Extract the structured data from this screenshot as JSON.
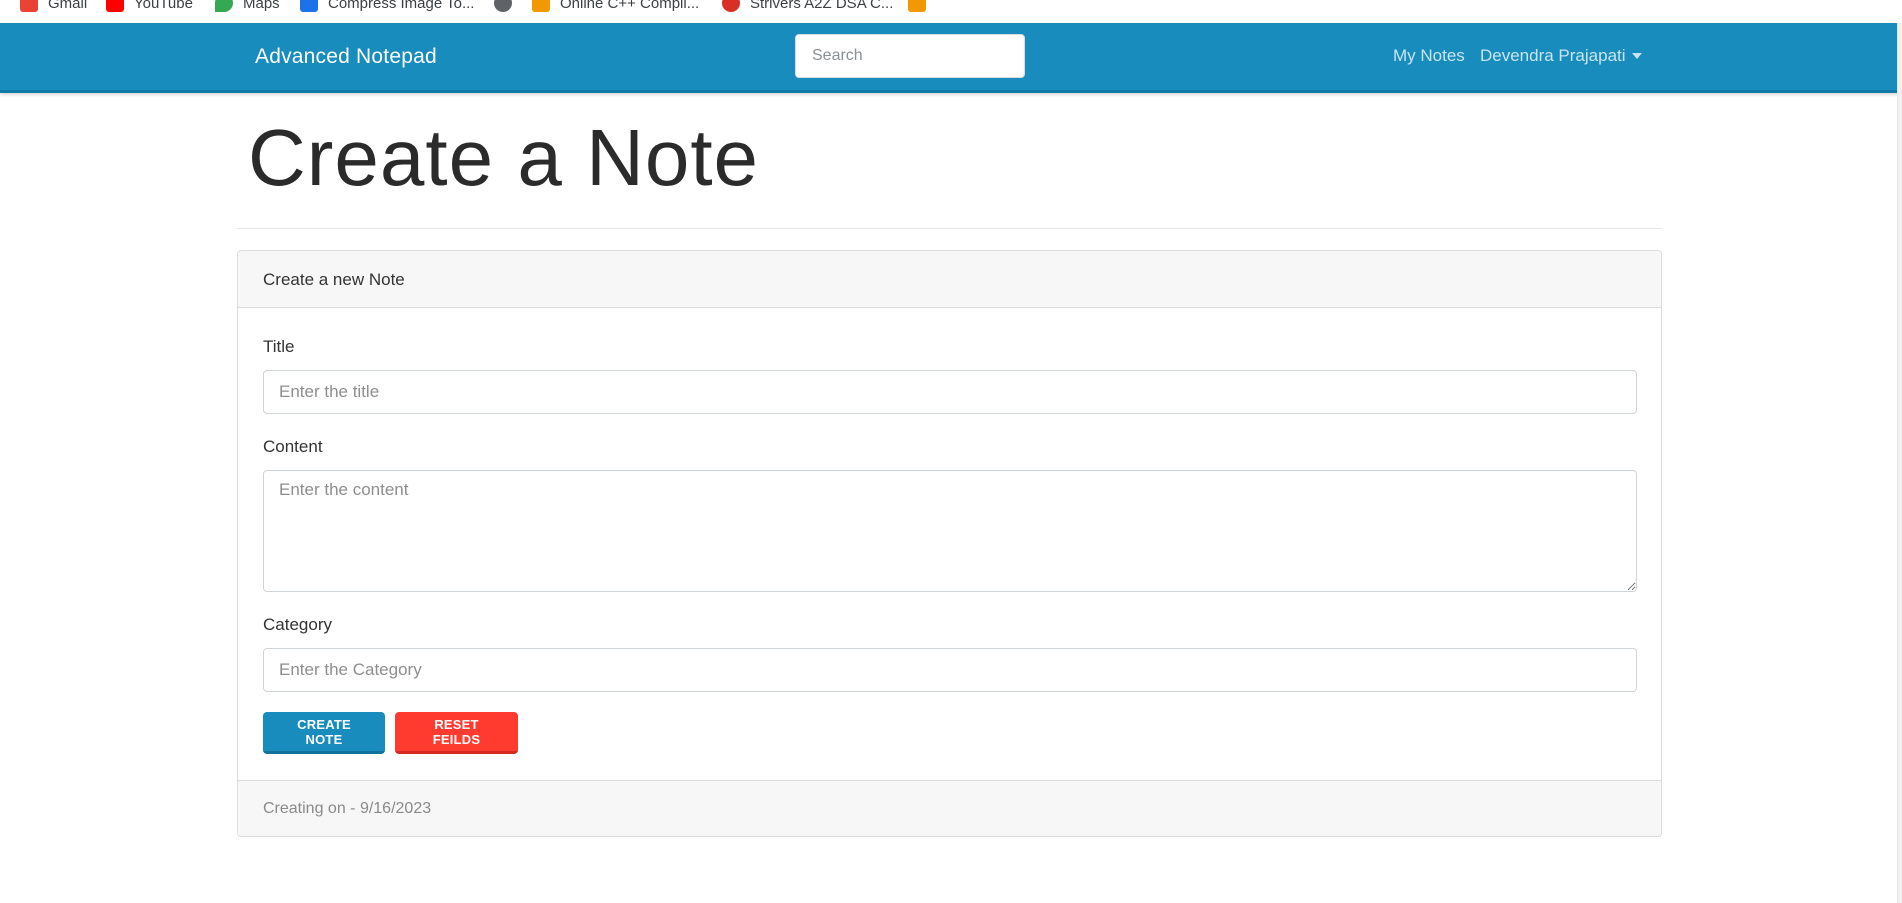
{
  "bookmarks": [
    {
      "label": "Gmail",
      "icon": "gmail-icon",
      "color": "#ea4335"
    },
    {
      "label": "YouTube",
      "icon": "youtube-icon",
      "color": "#ff0000"
    },
    {
      "label": "Maps",
      "icon": "maps-icon",
      "color": "#34a853"
    },
    {
      "label": "Compress Image To...",
      "icon": "compress-icon",
      "color": "#1a73e8"
    },
    {
      "label": "",
      "icon": "globe-icon",
      "color": "#5f6368"
    },
    {
      "label": "Online C++ Compil...",
      "icon": "compiler-icon",
      "color": "#f29900"
    },
    {
      "label": "Strivers A2Z DSA C...",
      "icon": "striver-icon",
      "color": "#d93025"
    },
    {
      "label": "",
      "icon": "pma-icon",
      "color": "#f29900"
    }
  ],
  "navbar": {
    "brand": "Advanced Notepad",
    "search_placeholder": "Search",
    "my_notes": "My Notes",
    "user_name": "Devendra Prajapati",
    "bg_color": "#178cbd"
  },
  "page": {
    "title": "Create a Note"
  },
  "card": {
    "header": "Create a new Note",
    "title_label": "Title",
    "title_placeholder": "Enter the title",
    "content_label": "Content",
    "content_placeholder": "Enter the content",
    "category_label": "Category",
    "category_placeholder": "Enter the Category",
    "create_button": "Create Note",
    "reset_button": "Reset Feilds",
    "footer": "Creating on - 9/16/2023"
  },
  "colors": {
    "primary": "#178cbd",
    "danger": "#ff3b2f"
  }
}
